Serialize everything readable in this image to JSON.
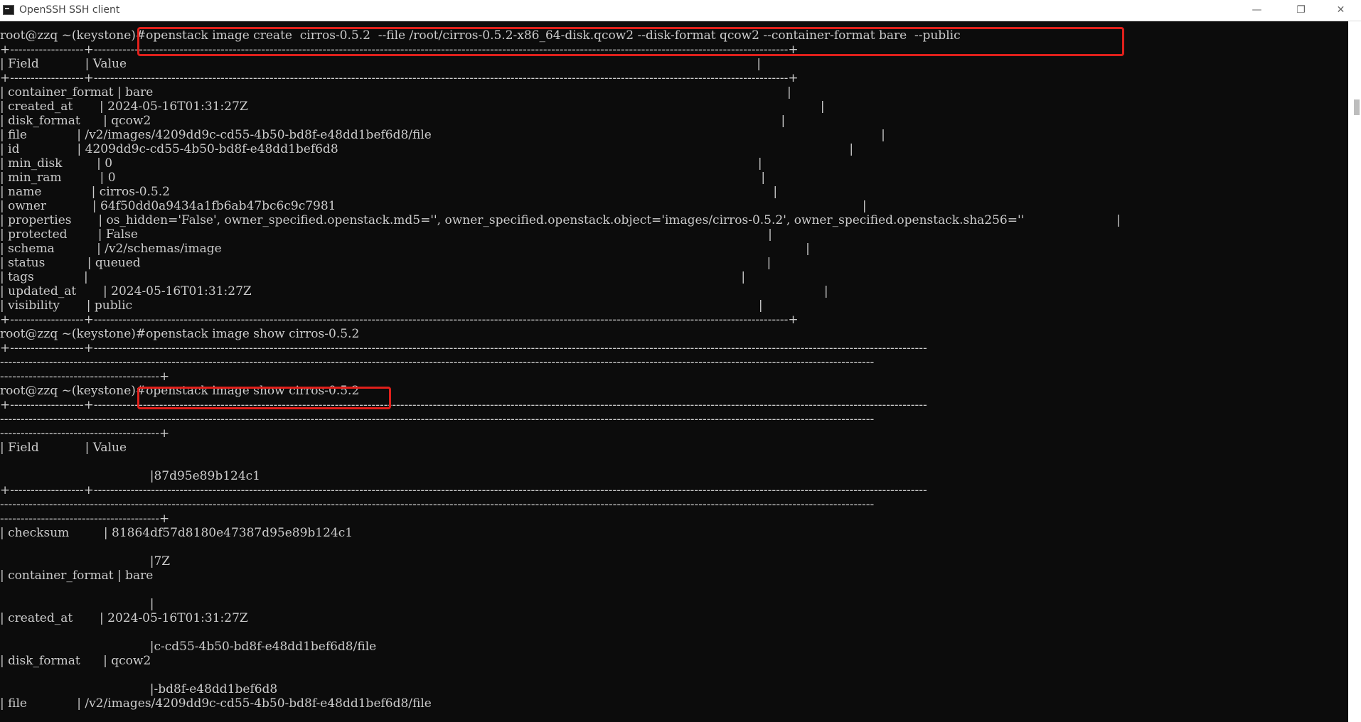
{
  "window": {
    "title": "OpenSSH SSH client",
    "minimize_icon": "minimize-icon",
    "restore_icon": "restore-icon",
    "close_icon": "close-icon"
  },
  "terminal": {
    "lines": [
      "root@zzq ~(keystone)#openstack image create  cirros-0.5.2  --file /root/cirros-0.5.2-x86_64-disk.qcow2 --disk-format qcow2 --container-format bare  --public",
      "+------------------+--------------------------------------------------------------------------------------------------------------------------------------------------------------------------+",
      "| Field            | Value                                                                                                                                                                    |",
      "+------------------+--------------------------------------------------------------------------------------------------------------------------------------------------------------------------+",
      "| container_format | bare                                                                                                                                                                     |",
      "| created_at       | 2024-05-16T01:31:27Z                                                                                                                                                     |",
      "| disk_format      | qcow2                                                                                                                                                                    |",
      "| file             | /v2/images/4209dd9c-cd55-4b50-bd8f-e48dd1bef6d8/file                                                                                                                     |",
      "| id               | 4209dd9c-cd55-4b50-bd8f-e48dd1bef6d8                                                                                                                                     |",
      "| min_disk         | 0                                                                                                                                                                        |",
      "| min_ram          | 0                                                                                                                                                                        |",
      "| name             | cirros-0.5.2                                                                                                                                                             |",
      "| owner            | 64f50dd0a9434a1fb6ab47bc6c9c7981                                                                                                                                         |",
      "| properties       | os_hidden='False', owner_specified.openstack.md5='', owner_specified.openstack.object='images/cirros-0.5.2', owner_specified.openstack.sha256=''                        |",
      "| protected        | False                                                                                                                                                                    |",
      "| schema           | /v2/schemas/image                                                                                                                                                        |",
      "| status           | queued                                                                                                                                                                   |",
      "| tags             |                                                                                                                                                                          |",
      "| updated_at       | 2024-05-16T01:31:27Z                                                                                                                                                     |",
      "| visibility       | public                                                                                                                                                                   |",
      "+------------------+--------------------------------------------------------------------------------------------------------------------------------------------------------------------------+",
      "root@zzq ~(keystone)#openstack image show cirros-0.5.2",
      "+------------------+------------------------------------------------------------------------------------------------------------------------------------------------------------------------------------------------------------",
      "----------------------------------------------------------------------------------------------------------------------------------------------------------------------------------------------------------------------",
      "---------------------------------------+",
      "root@zzq ~(keystone)#openstack image show cirros-0.5.2",
      "+------------------+------------------------------------------------------------------------------------------------------------------------------------------------------------------------------------------------------------",
      "----------------------------------------------------------------------------------------------------------------------------------------------------------------------------------------------------------------------",
      "---------------------------------------+",
      "| Field            | Value",
      "",
      "                                       |87d95e89b124c1",
      "+------------------+------------------------------------------------------------------------------------------------------------------------------------------------------------------------------------------------------------",
      "----------------------------------------------------------------------------------------------------------------------------------------------------------------------------------------------------------------------",
      "---------------------------------------+",
      "| checksum         | 81864df57d8180e47387d95e89b124c1",
      "",
      "                                       |7Z",
      "| container_format | bare",
      "",
      "                                       |",
      "| created_at       | 2024-05-16T01:31:27Z",
      "",
      "                                       |c-cd55-4b50-bd8f-e48dd1bef6d8/file",
      "| disk_format      | qcow2",
      "",
      "                                       |-bd8f-e48dd1bef6d8",
      "| file             | /v2/images/4209dd9c-cd55-4b50-bd8f-e48dd1bef6d8/file"
    ]
  }
}
